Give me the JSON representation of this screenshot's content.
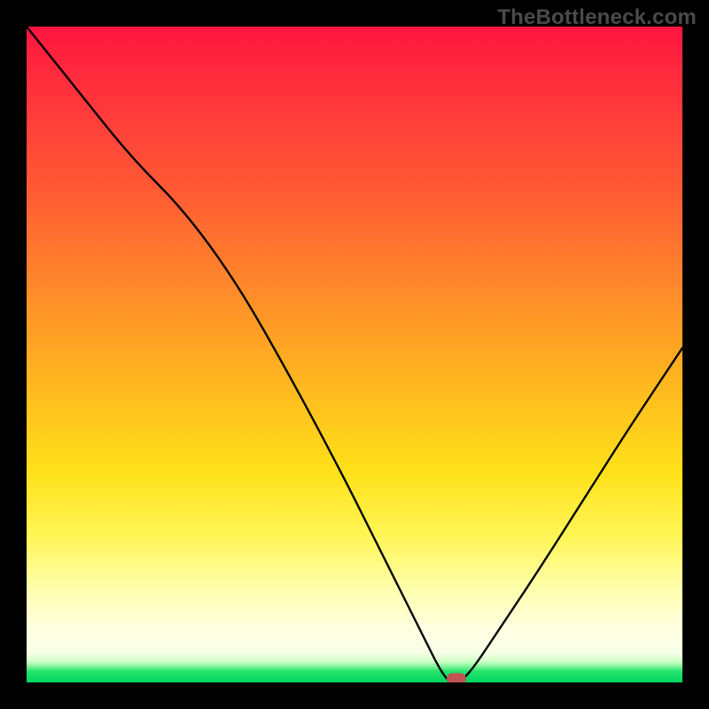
{
  "watermark": "TheBottleneck.com",
  "chart_data": {
    "type": "line",
    "title": "",
    "xlabel": "",
    "ylabel": "",
    "xlim": [
      0,
      100
    ],
    "ylim": [
      0,
      100
    ],
    "grid": false,
    "legend": false,
    "marker": {
      "x": 65.5,
      "y": 0,
      "color": "#c05454"
    },
    "series": [
      {
        "name": "bottleneck-curve",
        "color": "#000000",
        "x": [
          0,
          8,
          16,
          24,
          32,
          40,
          48,
          54,
          58,
          61,
          63,
          64.5,
          66,
          68,
          72,
          78,
          85,
          92,
          100
        ],
        "y": [
          100,
          90,
          80,
          72,
          61,
          47,
          32,
          20,
          12,
          6,
          2,
          0,
          0,
          2,
          8,
          17,
          28,
          39,
          51
        ]
      }
    ],
    "background_gradient": {
      "stops": [
        {
          "pos": 0,
          "color": "#ff153f"
        },
        {
          "pos": 0.25,
          "color": "#ff5a34"
        },
        {
          "pos": 0.55,
          "color": "#ffb91f"
        },
        {
          "pos": 0.78,
          "color": "#fff658"
        },
        {
          "pos": 0.92,
          "color": "#ffffe2"
        },
        {
          "pos": 0.983,
          "color": "#26e36e"
        },
        {
          "pos": 1.0,
          "color": "#00d660"
        }
      ]
    }
  }
}
